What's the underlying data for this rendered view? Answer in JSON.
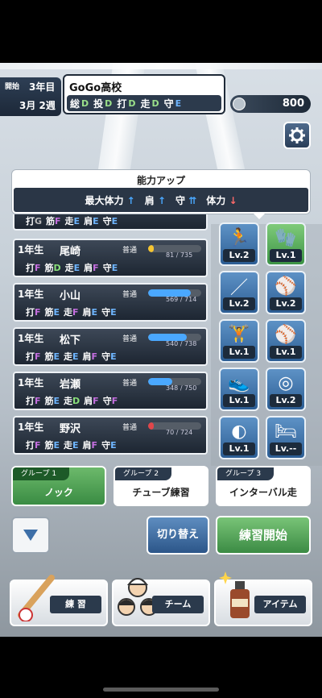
{
  "header": {
    "start_label": "開始",
    "year": "3年目",
    "week": "3月 2週",
    "school_name": "GoGo高校",
    "stats": [
      {
        "label": "総",
        "value": "D"
      },
      {
        "label": "投",
        "value": "D"
      },
      {
        "label": "打",
        "value": "D"
      },
      {
        "label": "走",
        "value": "D"
      },
      {
        "label": "守",
        "value": "E"
      }
    ],
    "coins": "800"
  },
  "ability": {
    "title": "能力アップ",
    "items": [
      {
        "label": "最大体力",
        "arrow": "↑",
        "dir": "up"
      },
      {
        "label": "肩",
        "arrow": "↑",
        "dir": "up"
      },
      {
        "label": "守",
        "arrow": "⇈",
        "dir": "up"
      },
      {
        "label": "体力",
        "arrow": "↓",
        "dir": "down"
      }
    ]
  },
  "roster": {
    "partial_stats": [
      {
        "l": "打",
        "v": "G"
      },
      {
        "l": "筋",
        "v": "F"
      },
      {
        "l": "走",
        "v": "E"
      },
      {
        "l": "肩",
        "v": "E"
      },
      {
        "l": "守",
        "v": "E"
      }
    ],
    "players": [
      {
        "grade": "1年生",
        "name": "尾崎",
        "condition": "普通",
        "stamina": "81 / 735",
        "ratio": 0.11,
        "bar_color": "#f5c531",
        "stats": [
          {
            "l": "打",
            "v": "F"
          },
          {
            "l": "筋",
            "v": "D"
          },
          {
            "l": "走",
            "v": "E"
          },
          {
            "l": "肩",
            "v": "F"
          },
          {
            "l": "守",
            "v": "E"
          }
        ]
      },
      {
        "grade": "1年生",
        "name": "小山",
        "condition": "普通",
        "stamina": "569 / 714",
        "ratio": 0.8,
        "bar_color": "#4aa8ff",
        "stats": [
          {
            "l": "打",
            "v": "F"
          },
          {
            "l": "筋",
            "v": "E"
          },
          {
            "l": "走",
            "v": "F"
          },
          {
            "l": "肩",
            "v": "E"
          },
          {
            "l": "守",
            "v": "E"
          }
        ]
      },
      {
        "grade": "1年生",
        "name": "松下",
        "condition": "普通",
        "stamina": "540 / 738",
        "ratio": 0.73,
        "bar_color": "#4aa8ff",
        "stats": [
          {
            "l": "打",
            "v": "F"
          },
          {
            "l": "筋",
            "v": "E"
          },
          {
            "l": "走",
            "v": "E"
          },
          {
            "l": "肩",
            "v": "F"
          },
          {
            "l": "守",
            "v": "E"
          }
        ]
      },
      {
        "grade": "1年生",
        "name": "岩瀬",
        "condition": "普通",
        "stamina": "348 / 750",
        "ratio": 0.46,
        "bar_color": "#4aa8ff",
        "stats": [
          {
            "l": "打",
            "v": "F"
          },
          {
            "l": "筋",
            "v": "E"
          },
          {
            "l": "走",
            "v": "D"
          },
          {
            "l": "肩",
            "v": "F"
          },
          {
            "l": "守",
            "v": "F"
          }
        ]
      },
      {
        "grade": "1年生",
        "name": "野沢",
        "condition": "普通",
        "stamina": "70 / 724",
        "ratio": 0.1,
        "bar_color": "#e0464a",
        "stats": [
          {
            "l": "打",
            "v": "F"
          },
          {
            "l": "筋",
            "v": "E"
          },
          {
            "l": "走",
            "v": "E"
          },
          {
            "l": "肩",
            "v": "F"
          },
          {
            "l": "守",
            "v": "E"
          }
        ]
      }
    ]
  },
  "practice": [
    {
      "icon": "running-icon",
      "glyph": "🏃",
      "level": "Lv.2",
      "green": false
    },
    {
      "icon": "glove-icon",
      "glyph": "🧤",
      "level": "Lv.1",
      "green": true
    },
    {
      "icon": "bat-icon",
      "glyph": "／",
      "level": "Lv.2",
      "green": false
    },
    {
      "icon": "batting-drill-icon",
      "glyph": "⚾",
      "level": "Lv.2",
      "green": false
    },
    {
      "icon": "dumbbell-icon",
      "glyph": "🏋",
      "level": "Lv.1",
      "green": false
    },
    {
      "icon": "pitching-drill-icon",
      "glyph": "⚾",
      "level": "Lv.1",
      "green": false
    },
    {
      "icon": "cleat-icon",
      "glyph": "👟",
      "level": "Lv.1",
      "green": false
    },
    {
      "icon": "target-icon",
      "glyph": "◎",
      "level": "Lv.2",
      "green": false
    },
    {
      "icon": "ball-icon",
      "glyph": "◐",
      "level": "Lv.1",
      "green": false
    },
    {
      "icon": "bed-icon",
      "glyph": "🛏",
      "level": "Lv.--",
      "green": false
    }
  ],
  "groups": [
    {
      "tag": "グループ 1",
      "label": "ノック",
      "active": true
    },
    {
      "tag": "グループ 2",
      "label": "チューブ練習",
      "active": false
    },
    {
      "tag": "グループ 3",
      "label": "インターバル走",
      "active": false
    }
  ],
  "controls": {
    "switch": "切り替え",
    "start": "練習開始"
  },
  "menu": [
    {
      "label": "練 習",
      "icon": "bat-ball-icon"
    },
    {
      "label": "チーム",
      "icon": "team-icon"
    },
    {
      "label": "アイテム",
      "icon": "bottle-icon"
    }
  ]
}
